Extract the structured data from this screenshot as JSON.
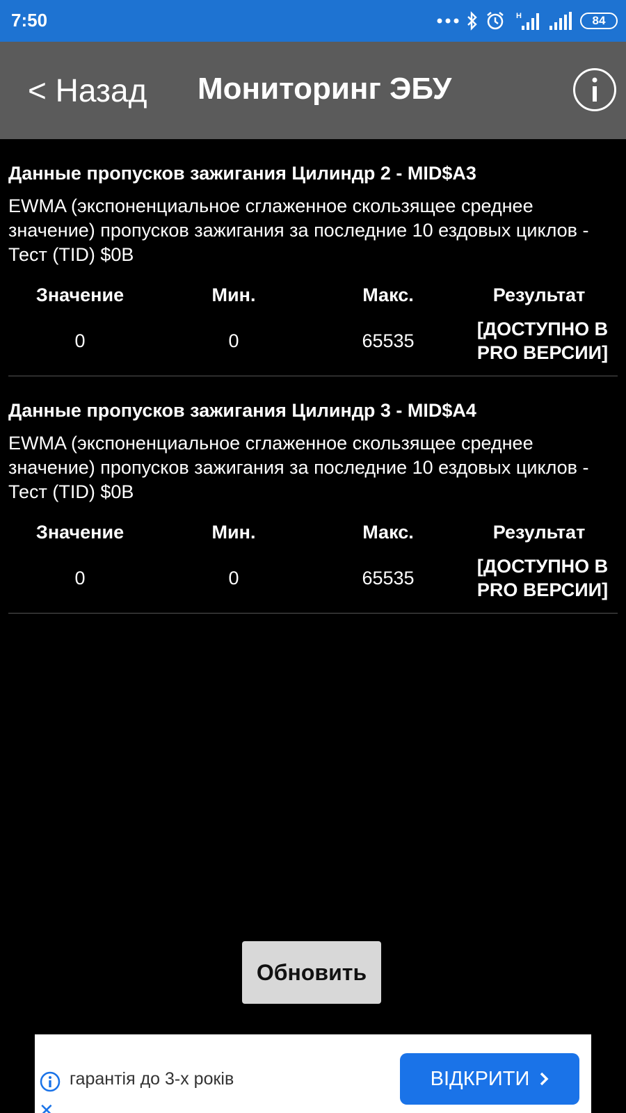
{
  "status": {
    "time": "7:50",
    "battery": "84"
  },
  "header": {
    "back_label": "< Назад",
    "title": "Мониторинг ЭБУ"
  },
  "sections": [
    {
      "title": "Данные пропусков зажигания Цилиндр 2 - MID$A3",
      "description": "EWMA (экспоненциальное сглаженное скользящее среднее значение) пропусков зажигания за последние 10 ездовых циклов - Тест (TID) $0B",
      "columns": [
        "Значение",
        "Мин.",
        "Макс.",
        "Результат"
      ],
      "value": "0",
      "min": "0",
      "max": "65535",
      "result_line1": "[ДОСТУПНО В",
      "result_line2": "PRO ВЕРСИИ]"
    },
    {
      "title": "Данные пропусков зажигания Цилиндр 3 - MID$A4",
      "description": "EWMA (экспоненциальное сглаженное скользящее среднее значение) пропусков зажигания за последние 10 ездовых циклов - Тест (TID) $0B",
      "columns": [
        "Значение",
        "Мин.",
        "Макс.",
        "Результат"
      ],
      "value": "0",
      "min": "0",
      "max": "65535",
      "result_line1": "[ДОСТУПНО В",
      "result_line2": "PRO ВЕРСИИ]"
    }
  ],
  "refresh_label": "Обновить",
  "ad": {
    "text": "гарантія до 3-х років",
    "button_label": "ВІДКРИТИ",
    "close_glyph": "✕"
  },
  "colors": {
    "status_bar": "#1e73d2",
    "app_bar": "#5b5b5b",
    "background": "#000000",
    "ad_button": "#1a73e8"
  }
}
